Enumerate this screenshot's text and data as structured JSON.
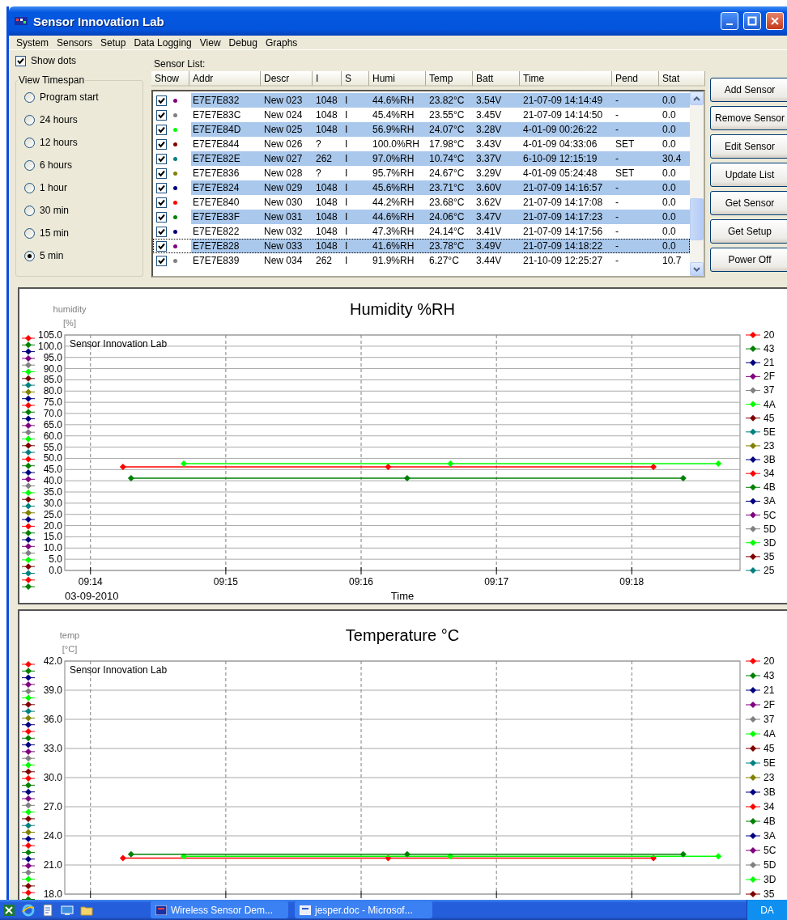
{
  "window": {
    "title": "Sensor Innovation Lab"
  },
  "menu": [
    "System",
    "Sensors",
    "Setup",
    "Data Logging",
    "View",
    "Debug",
    "Graphs"
  ],
  "show_dots": {
    "label": "Show dots",
    "checked": true
  },
  "timespan": {
    "title": "View Timespan",
    "options": [
      {
        "label": "Program start",
        "selected": false
      },
      {
        "label": "24 hours",
        "selected": false
      },
      {
        "label": "12 hours",
        "selected": false
      },
      {
        "label": "6 hours",
        "selected": false
      },
      {
        "label": "1 hour",
        "selected": false
      },
      {
        "label": "30 min",
        "selected": false
      },
      {
        "label": "15 min",
        "selected": false
      },
      {
        "label": "5 min",
        "selected": true
      }
    ]
  },
  "sensor_list": {
    "label": "Sensor List:",
    "columns": [
      "Show",
      "Addr",
      "Descr",
      "I",
      "S",
      "Humi",
      "Temp",
      "Batt",
      "Time",
      "Pend",
      "Stat"
    ],
    "rows": [
      {
        "checked": true,
        "color": "#800080",
        "selected": true,
        "focused": false,
        "cells": [
          "",
          "E7E7E832",
          "New 023",
          "1048",
          "I",
          "44.6%RH",
          "23.82°C",
          "3.54V",
          "21-07-09 14:14:49",
          "-",
          "0.0"
        ]
      },
      {
        "checked": true,
        "color": "#808080",
        "selected": false,
        "focused": false,
        "cells": [
          "",
          "E7E7E83C",
          "New 024",
          "1048",
          "I",
          "45.4%RH",
          "23.55°C",
          "3.45V",
          "21-07-09 14:14:50",
          "-",
          "0.0"
        ]
      },
      {
        "checked": true,
        "color": "#00ff00",
        "selected": true,
        "focused": false,
        "cells": [
          "",
          "E7E7E84D",
          "New 025",
          "1048",
          "I",
          "56.9%RH",
          "24.07°C",
          "3.28V",
          "4-01-09 00:26:22",
          "-",
          "0.0"
        ]
      },
      {
        "checked": true,
        "color": "#800000",
        "selected": false,
        "focused": false,
        "cells": [
          "",
          "E7E7E844",
          "New 026",
          "?",
          "I",
          "100.0%RH",
          "17.98°C",
          "3.43V",
          "4-01-09 04:33:06",
          "SET",
          "0.0"
        ]
      },
      {
        "checked": true,
        "color": "#008080",
        "selected": true,
        "focused": false,
        "cells": [
          "",
          "E7E7E82E",
          "New 027",
          "262",
          "I",
          "97.0%RH",
          "10.74°C",
          "3.37V",
          "6-10-09 12:15:19",
          "-",
          "30.4"
        ]
      },
      {
        "checked": true,
        "color": "#808000",
        "selected": false,
        "focused": false,
        "cells": [
          "",
          "E7E7E836",
          "New 028",
          "?",
          "I",
          "95.7%RH",
          "24.67°C",
          "3.29V",
          "4-01-09 05:24:48",
          "SET",
          "0.0"
        ]
      },
      {
        "checked": true,
        "color": "#000080",
        "selected": true,
        "focused": false,
        "cells": [
          "",
          "E7E7E824",
          "New 029",
          "1048",
          "I",
          "45.6%RH",
          "23.71°C",
          "3.60V",
          "21-07-09 14:16:57",
          "-",
          "0.0"
        ]
      },
      {
        "checked": true,
        "color": "#ff0000",
        "selected": false,
        "focused": false,
        "cells": [
          "",
          "E7E7E840",
          "New 030",
          "1048",
          "I",
          "44.2%RH",
          "23.68°C",
          "3.62V",
          "21-07-09 14:17:08",
          "-",
          "0.0"
        ]
      },
      {
        "checked": true,
        "color": "#008000",
        "selected": true,
        "focused": false,
        "cells": [
          "",
          "E7E7E83F",
          "New 031",
          "1048",
          "I",
          "44.6%RH",
          "24.06°C",
          "3.47V",
          "21-07-09 14:17:23",
          "-",
          "0.0"
        ]
      },
      {
        "checked": true,
        "color": "#000080",
        "selected": false,
        "focused": false,
        "cells": [
          "",
          "E7E7E822",
          "New 032",
          "1048",
          "I",
          "47.3%RH",
          "24.14°C",
          "3.41V",
          "21-07-09 14:17:56",
          "-",
          "0.0"
        ]
      },
      {
        "checked": true,
        "color": "#800080",
        "selected": true,
        "focused": true,
        "cells": [
          "",
          "E7E7E828",
          "New 033",
          "1048",
          "I",
          "41.6%RH",
          "23.78°C",
          "3.49V",
          "21-07-09 14:18:22",
          "-",
          "0.0"
        ]
      },
      {
        "checked": true,
        "color": "#808080",
        "selected": false,
        "focused": false,
        "cells": [
          "",
          "E7E7E839",
          "New 034",
          "262",
          "I",
          "91.9%RH",
          "6.27°C",
          "3.44V",
          "21-10-09 12:25:27",
          "-",
          "10.7"
        ]
      }
    ]
  },
  "buttons": [
    "Add Sensor",
    "Remove Sensor",
    "Edit Sensor",
    "Update List",
    "Get Sensor",
    "Get Setup",
    "Power Off"
  ],
  "charts": [
    {
      "unit": "[%]",
      "date": "03-09-2010",
      "legend": [
        {
          "label": "20",
          "color": "#ff0000"
        },
        {
          "label": "43",
          "color": "#008000"
        },
        {
          "label": "21",
          "color": "#000080"
        },
        {
          "label": "2F",
          "color": "#800080"
        },
        {
          "label": "37",
          "color": "#808080"
        },
        {
          "label": "4A",
          "color": "#00ff00"
        },
        {
          "label": "45",
          "color": "#800000"
        },
        {
          "label": "5E",
          "color": "#008080"
        },
        {
          "label": "23",
          "color": "#808000"
        },
        {
          "label": "3B",
          "color": "#000080"
        },
        {
          "label": "34",
          "color": "#ff0000"
        },
        {
          "label": "4B",
          "color": "#008000"
        },
        {
          "label": "3A",
          "color": "#000080"
        },
        {
          "label": "5C",
          "color": "#800080"
        },
        {
          "label": "5D",
          "color": "#808080"
        },
        {
          "label": "3D",
          "color": "#00ff00"
        },
        {
          "label": "35",
          "color": "#800000"
        },
        {
          "label": "25",
          "color": "#008080"
        }
      ],
      "chart_data": {
        "type": "line",
        "grid": true,
        "title": "Humidity %RH",
        "xlabel": "Time",
        "ylabel": "humidity",
        "xlim": [
          553.81,
          558.8
        ],
        "ylim": [
          0,
          105
        ],
        "xticks": [
          {
            "value": 554,
            "label": "09:14"
          },
          {
            "value": 555,
            "label": "09:15"
          },
          {
            "value": 556,
            "label": "09:16"
          },
          {
            "value": 557,
            "label": "09:17"
          },
          {
            "value": 558,
            "label": "09:18"
          }
        ],
        "yticks": [
          {
            "value": 0,
            "label": "0.0"
          },
          {
            "value": 5,
            "label": "5.0"
          },
          {
            "value": 10,
            "label": "10.0"
          },
          {
            "value": 15,
            "label": "15.0"
          },
          {
            "value": 20,
            "label": "20.0"
          },
          {
            "value": 25,
            "label": "25.0"
          },
          {
            "value": 30,
            "label": "30.0"
          },
          {
            "value": 35,
            "label": "35.0"
          },
          {
            "value": 40,
            "label": "40.0"
          },
          {
            "value": 45,
            "label": "45.0"
          },
          {
            "value": 50,
            "label": "50.0"
          },
          {
            "value": 55,
            "label": "55.0"
          },
          {
            "value": 60,
            "label": "60.0"
          },
          {
            "value": 65,
            "label": "65.0"
          },
          {
            "value": 70,
            "label": "70.0"
          },
          {
            "value": 75,
            "label": "75.0"
          },
          {
            "value": 80,
            "label": "80.0"
          },
          {
            "value": 85,
            "label": "85.0"
          },
          {
            "value": 90,
            "label": "90.0"
          },
          {
            "value": 95,
            "label": "95.0"
          },
          {
            "value": 100,
            "label": "100.0"
          },
          {
            "value": 105,
            "label": "105.0"
          }
        ],
        "annotations": [
          {
            "text": "Sensor Innovation Lab"
          }
        ],
        "series": [
          {
            "color": "#ff0000",
            "marker": "diamond",
            "x": [
              554.24,
              556.2,
              558.16
            ],
            "values": [
              46.2,
              46.2,
              46.2
            ]
          },
          {
            "color": "#00ff00",
            "marker": "diamond",
            "x": [
              554.69,
              556.66,
              558.64
            ],
            "values": [
              47.6,
              47.6,
              47.6
            ]
          },
          {
            "color": "#008000",
            "marker": "diamond",
            "x": [
              554.3,
              556.34,
              558.38
            ],
            "values": [
              41.1,
              41.1,
              41.1
            ]
          }
        ]
      }
    },
    {
      "unit": "[°C]",
      "legend": [
        {
          "label": "20",
          "color": "#ff0000"
        },
        {
          "label": "43",
          "color": "#008000"
        },
        {
          "label": "21",
          "color": "#000080"
        },
        {
          "label": "2F",
          "color": "#800080"
        },
        {
          "label": "37",
          "color": "#808080"
        },
        {
          "label": "4A",
          "color": "#00ff00"
        },
        {
          "label": "45",
          "color": "#800000"
        },
        {
          "label": "5E",
          "color": "#008080"
        },
        {
          "label": "23",
          "color": "#808000"
        },
        {
          "label": "3B",
          "color": "#000080"
        },
        {
          "label": "34",
          "color": "#ff0000"
        },
        {
          "label": "4B",
          "color": "#008000"
        },
        {
          "label": "3A",
          "color": "#000080"
        },
        {
          "label": "5C",
          "color": "#800080"
        },
        {
          "label": "5D",
          "color": "#808080"
        },
        {
          "label": "3D",
          "color": "#00ff00"
        },
        {
          "label": "35",
          "color": "#800000"
        }
      ],
      "chart_data": {
        "type": "line",
        "grid": true,
        "title": "Temperature °C",
        "ylabel": "temp",
        "xlim": [
          553.81,
          558.8
        ],
        "ylim": [
          18,
          42
        ],
        "yticks": [
          {
            "value": 18,
            "label": "18.0"
          },
          {
            "value": 21,
            "label": "21.0"
          },
          {
            "value": 24,
            "label": "24.0"
          },
          {
            "value": 27,
            "label": "27.0"
          },
          {
            "value": 30,
            "label": "30.0"
          },
          {
            "value": 33,
            "label": "33.0"
          },
          {
            "value": 36,
            "label": "36.0"
          },
          {
            "value": 39,
            "label": "39.0"
          },
          {
            "value": 42,
            "label": "42.0"
          }
        ],
        "annotations": [
          {
            "text": "Sensor Innovation Lab"
          }
        ],
        "series": [
          {
            "color": "#ff0000",
            "marker": "diamond",
            "x": [
              554.24,
              556.2,
              558.16
            ],
            "values": [
              21.7,
              21.7,
              21.7
            ]
          },
          {
            "color": "#00ff00",
            "marker": "diamond",
            "x": [
              554.69,
              556.66,
              558.64
            ],
            "values": [
              21.9,
              21.9,
              21.9
            ]
          },
          {
            "color": "#008000",
            "marker": "diamond",
            "x": [
              554.3,
              556.34,
              558.38
            ],
            "values": [
              22.1,
              22.1,
              22.1
            ]
          }
        ]
      }
    }
  ],
  "taskbar": {
    "tasks": [
      "Wireless Sensor Dem...",
      "jesper.doc - Microsof..."
    ],
    "tray": "DA"
  }
}
